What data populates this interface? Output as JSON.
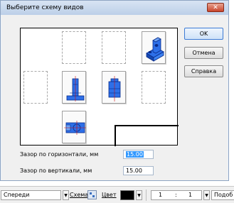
{
  "dialog": {
    "title": "Выберите схему видов",
    "close_glyph": "✕",
    "buttons": {
      "ok": "OK",
      "cancel": "Отмена",
      "help": "Справка"
    },
    "gap_horizontal": {
      "label": "Зазор по горизонтали, мм",
      "value": "15.00"
    },
    "gap_vertical": {
      "label": "Зазор по вертикали, мм",
      "value": "15.00"
    },
    "accent_color": "#1a5fe0"
  },
  "toolbar": {
    "view": "Спереди",
    "scheme_label": "Схема",
    "color_label": "Цвет",
    "scale_left": "1",
    "scale_sep": ":",
    "scale_right": "1",
    "trailing_label": "Подоб"
  }
}
